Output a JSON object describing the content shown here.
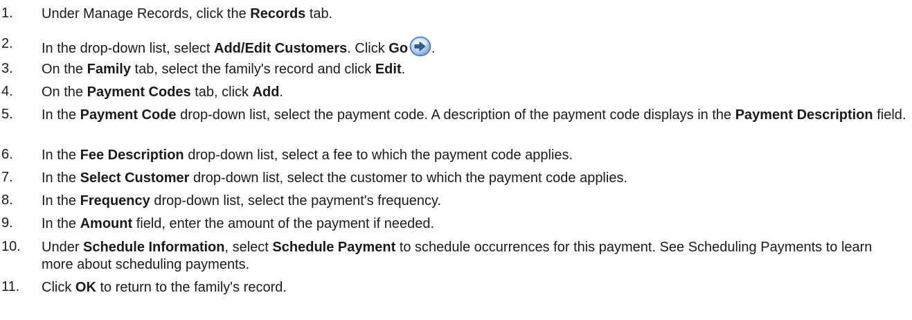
{
  "steps": [
    {
      "num": "1.",
      "parts": [
        [
          "n",
          "Under Manage Records, click the "
        ],
        [
          "b",
          "Records"
        ],
        [
          "n",
          " tab."
        ]
      ]
    },
    {
      "num": "2.",
      "parts": [
        [
          "n",
          "In the drop-down list, select "
        ],
        [
          "b",
          "Add/Edit Customers"
        ],
        [
          "n",
          ". Click "
        ],
        [
          "b",
          "Go"
        ],
        [
          "icon",
          "go-arrow-icon"
        ],
        [
          "n",
          "."
        ]
      ]
    },
    {
      "num": "3.",
      "parts": [
        [
          "n",
          "On the "
        ],
        [
          "b",
          "Family"
        ],
        [
          "n",
          " tab, select the family's record and click "
        ],
        [
          "b",
          "Edit"
        ],
        [
          "n",
          "."
        ]
      ]
    },
    {
      "num": "4.",
      "parts": [
        [
          "n",
          "On the "
        ],
        [
          "b",
          "Payment Codes"
        ],
        [
          "n",
          " tab, click "
        ],
        [
          "b",
          "Add"
        ],
        [
          "n",
          "."
        ]
      ]
    },
    {
      "num": "5.",
      "parts": [
        [
          "n",
          "In the "
        ],
        [
          "b",
          "Payment Code"
        ],
        [
          "n",
          " drop-down list, select the payment code. A description of the payment code displays in the "
        ],
        [
          "b",
          "Payment Description"
        ],
        [
          "n",
          " field."
        ]
      ]
    },
    {
      "num": "6.",
      "parts": [
        [
          "n",
          "In the "
        ],
        [
          "b",
          "Fee Description"
        ],
        [
          "n",
          " drop-down list, select a fee to which the payment code applies."
        ]
      ]
    },
    {
      "num": "7.",
      "parts": [
        [
          "n",
          "In the "
        ],
        [
          "b",
          "Select Customer"
        ],
        [
          "n",
          " drop-down list, select the customer to which the payment code applies."
        ]
      ]
    },
    {
      "num": "8.",
      "parts": [
        [
          "n",
          "In the "
        ],
        [
          "b",
          "Frequency"
        ],
        [
          "n",
          " drop-down list, select the payment's frequency."
        ]
      ]
    },
    {
      "num": "9.",
      "parts": [
        [
          "n",
          "In the "
        ],
        [
          "b",
          "Amount"
        ],
        [
          "n",
          " field, enter the amount of the payment if needed."
        ]
      ]
    },
    {
      "num": "10.",
      "parts": [
        [
          "n",
          "Under "
        ],
        [
          "b",
          "Schedule Information"
        ],
        [
          "n",
          ", select "
        ],
        [
          "b",
          "Schedule Payment"
        ],
        [
          "n",
          " to schedule occurrences for this payment. See Scheduling Payments to learn more about scheduling payments."
        ]
      ]
    },
    {
      "num": "11.",
      "parts": [
        [
          "n",
          "Click "
        ],
        [
          "b",
          "OK"
        ],
        [
          "n",
          " to return to the family's record."
        ]
      ]
    }
  ]
}
